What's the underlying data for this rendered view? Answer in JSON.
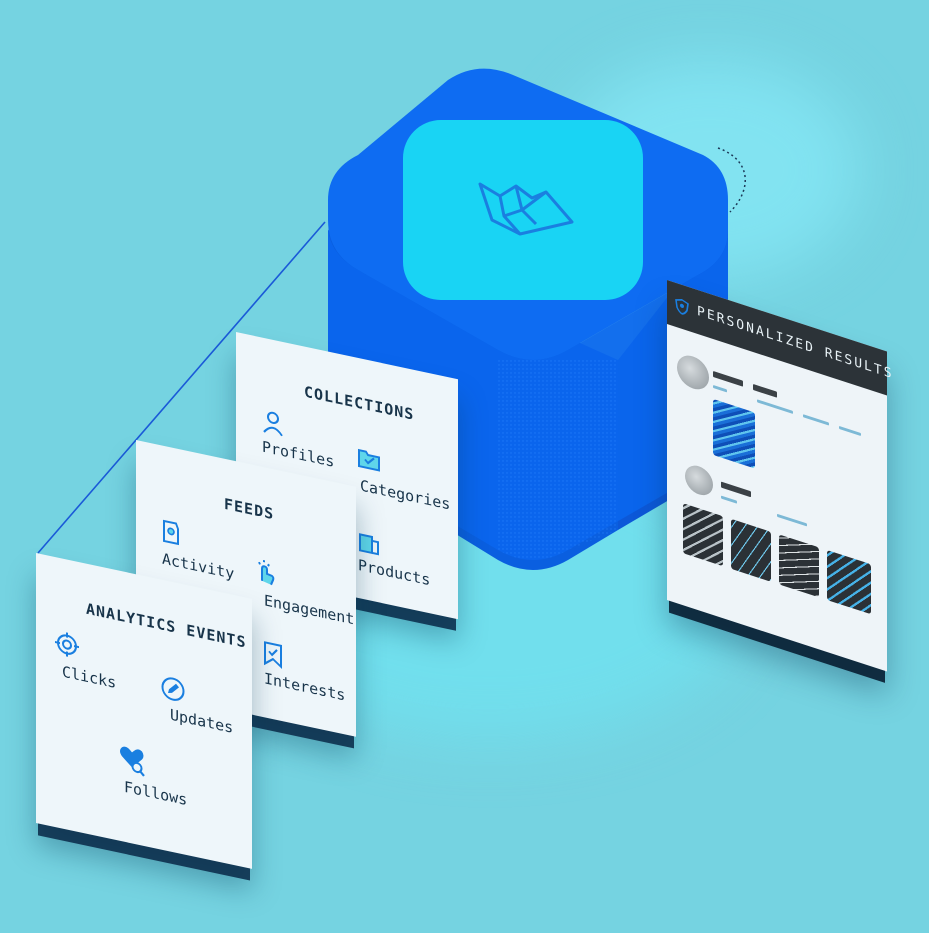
{
  "collections": {
    "title": "COLLECTIONS",
    "items": [
      {
        "label": "Profiles",
        "icon": "user-icon"
      },
      {
        "label": "Categories",
        "icon": "folder-icon"
      },
      {
        "label": "Products",
        "icon": "product-icon"
      }
    ]
  },
  "feeds": {
    "title": "FEEDS",
    "items": [
      {
        "label": "Activity",
        "icon": "activity-icon"
      },
      {
        "label": "Engagement",
        "icon": "tap-icon"
      },
      {
        "label": "Interests",
        "icon": "bookmark-icon"
      }
    ]
  },
  "analytics": {
    "title": "ANALYTICS EVENTS",
    "items": [
      {
        "label": "Clicks",
        "icon": "target-icon"
      },
      {
        "label": "Updates",
        "icon": "pencil-icon"
      },
      {
        "label": "Follows",
        "icon": "heart-search-icon"
      }
    ]
  },
  "results": {
    "title": "PERSONALIZED RESULTS",
    "icon": "shield-icon"
  },
  "logo": {
    "icon": "boat-logo-icon"
  },
  "colors": {
    "background": "#75d3e1",
    "cube": "#0e6cf2",
    "cube_top": "#1ad6f5",
    "icon_accent": "#1a7fe0",
    "panel": "#eef6fa",
    "results_bar": "#2c3338"
  }
}
